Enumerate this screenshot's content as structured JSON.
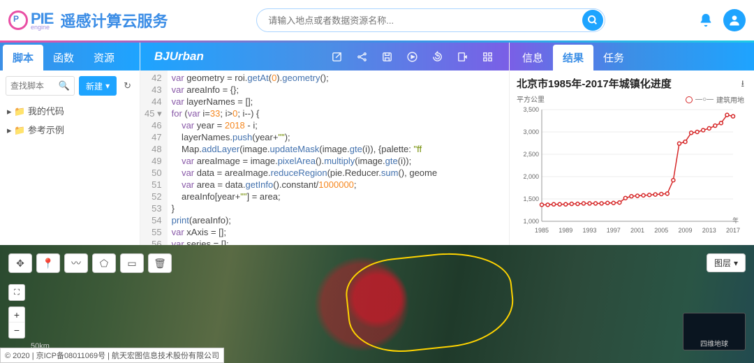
{
  "header": {
    "logo_main": "PIE",
    "logo_sub": "engine",
    "title": "遥感计算云服务",
    "search_placeholder": "请输入地点或者数据资源名称..."
  },
  "left_tabs": [
    "脚本",
    "函数",
    "资源"
  ],
  "left_active": 0,
  "script_search_placeholder": "查找脚本",
  "new_button": "新建",
  "tree": [
    {
      "label": "我的代码"
    },
    {
      "label": "参考示例"
    }
  ],
  "center": {
    "title": "BJUrban",
    "line_start": 42,
    "code_lines": [
      [
        [
          "kw",
          "var"
        ],
        [
          "punc",
          " geometry = roi."
        ],
        [
          "fn",
          "getAt"
        ],
        [
          "punc",
          "("
        ],
        [
          "num",
          "0"
        ],
        [
          "punc",
          ")."
        ],
        [
          "fn",
          "geometry"
        ],
        [
          "punc",
          "();"
        ]
      ],
      [
        [
          "kw",
          "var"
        ],
        [
          "punc",
          " areaInfo = {};"
        ]
      ],
      [
        [
          "kw",
          "var"
        ],
        [
          "punc",
          " layerNames = [];"
        ]
      ],
      [
        [
          "kw",
          "for"
        ],
        [
          "punc",
          " ("
        ],
        [
          "kw",
          "var"
        ],
        [
          "punc",
          " i="
        ],
        [
          "num",
          "33"
        ],
        [
          "punc",
          "; i>"
        ],
        [
          "num",
          "0"
        ],
        [
          "punc",
          "; i--) {"
        ]
      ],
      [
        [
          "punc",
          "    "
        ],
        [
          "kw",
          "var"
        ],
        [
          "punc",
          " year = "
        ],
        [
          "num",
          "2018"
        ],
        [
          "punc",
          " - i;"
        ]
      ],
      [
        [
          "punc",
          "    layerNames."
        ],
        [
          "fn",
          "push"
        ],
        [
          "punc",
          "(year+"
        ],
        [
          "str",
          "\"\""
        ],
        [
          "punc",
          ");"
        ]
      ],
      [
        [
          "punc",
          "    Map."
        ],
        [
          "fn",
          "addLayer"
        ],
        [
          "punc",
          "(image."
        ],
        [
          "fn",
          "updateMask"
        ],
        [
          "punc",
          "(image."
        ],
        [
          "fn",
          "gte"
        ],
        [
          "punc",
          "(i)), {palette: "
        ],
        [
          "str",
          "\"ff"
        ]
      ],
      [
        [
          "punc",
          "    "
        ],
        [
          "kw",
          "var"
        ],
        [
          "punc",
          " areaImage = image."
        ],
        [
          "fn",
          "pixelArea"
        ],
        [
          "punc",
          "()."
        ],
        [
          "fn",
          "multiply"
        ],
        [
          "punc",
          "(image."
        ],
        [
          "fn",
          "gte"
        ],
        [
          "punc",
          "(i));"
        ]
      ],
      [
        [
          "punc",
          "    "
        ],
        [
          "kw",
          "var"
        ],
        [
          "punc",
          " data = areaImage."
        ],
        [
          "fn",
          "reduceRegion"
        ],
        [
          "punc",
          "(pie.Reducer."
        ],
        [
          "fn",
          "sum"
        ],
        [
          "punc",
          "(), geome"
        ]
      ],
      [
        [
          "punc",
          "    "
        ],
        [
          "kw",
          "var"
        ],
        [
          "punc",
          " area = data."
        ],
        [
          "fn",
          "getInfo"
        ],
        [
          "punc",
          "().constant/"
        ],
        [
          "num",
          "1000000"
        ],
        [
          "punc",
          ";"
        ]
      ],
      [
        [
          "punc",
          "    areaInfo[year+"
        ],
        [
          "str",
          "\"\""
        ],
        [
          "punc",
          "] = area;"
        ]
      ],
      [
        [
          "punc",
          "}"
        ]
      ],
      [
        [
          "fn",
          "print"
        ],
        [
          "punc",
          "(areaInfo);"
        ]
      ],
      [
        [
          "kw",
          "var"
        ],
        [
          "punc",
          " xAxis = [];"
        ]
      ],
      [
        [
          "kw",
          "var"
        ],
        [
          "punc",
          " series = [];"
        ]
      ]
    ]
  },
  "right_tabs": [
    "信息",
    "结果",
    "任务"
  ],
  "right_active": 1,
  "chart_data": {
    "type": "line",
    "title": "北京市1985年-2017年城镇化进度",
    "ylabel": "平方公里",
    "xlabel": "年",
    "legend": "建筑用地",
    "ylim": [
      1000,
      3500
    ],
    "yticks": [
      1000,
      1500,
      2000,
      2500,
      3000,
      3500
    ],
    "xticks": [
      1985,
      1989,
      1993,
      1997,
      2001,
      2005,
      2009,
      2013,
      2017
    ],
    "x": [
      1985,
      1986,
      1987,
      1988,
      1989,
      1990,
      1991,
      1992,
      1993,
      1994,
      1995,
      1996,
      1997,
      1998,
      1999,
      2000,
      2001,
      2002,
      2003,
      2004,
      2005,
      2006,
      2007,
      2008,
      2009,
      2010,
      2011,
      2012,
      2013,
      2014,
      2015,
      2016,
      2017
    ],
    "values": [
      1370,
      1370,
      1380,
      1380,
      1380,
      1390,
      1390,
      1400,
      1400,
      1400,
      1400,
      1410,
      1410,
      1420,
      1520,
      1560,
      1570,
      1580,
      1590,
      1600,
      1610,
      1620,
      1920,
      2740,
      2780,
      2980,
      3000,
      3040,
      3080,
      3140,
      3200,
      3380,
      3350
    ]
  },
  "map": {
    "layer_button": "图层",
    "scale": "50km",
    "inset_label": "四维地球",
    "footer": "© 2020 | 京ICP备08011069号 | 航天宏图信息技术股份有限公司"
  }
}
